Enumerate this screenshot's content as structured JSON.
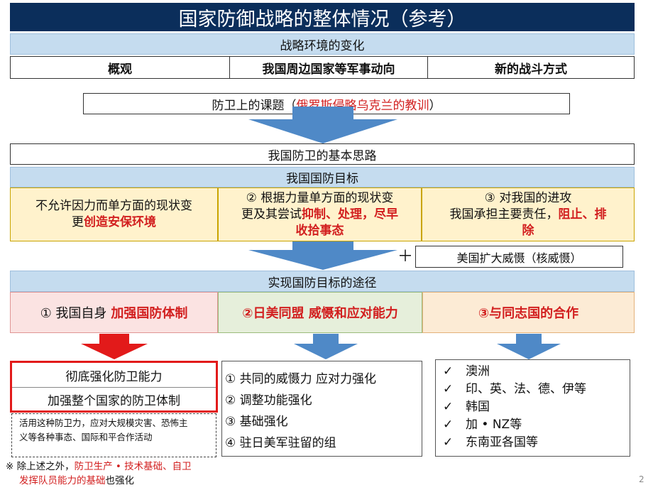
{
  "title": "国家防御战略的整体情况（参考）",
  "env_change": "战略环境的变化",
  "env_columns": [
    "概观",
    "我国周边国家等军事动向",
    "新的战斗方式"
  ],
  "issues": {
    "prefix": "防卫上的课题（",
    "highlight": "俄罗斯侵略乌克兰的教训",
    "suffix": "）"
  },
  "basic_thinking": "我国防卫的基本思路",
  "defense_goals_header": "我国国防目标",
  "goals": {
    "g1": {
      "line1": "不允许因力而单方面的现状变",
      "line2_plain": "更",
      "line2_red": "创造安保环境"
    },
    "g2": {
      "line1": "② 根据力量单方面的现状变",
      "line2_plain": "更及其尝试",
      "line2_red": "抑制、处理，尽早",
      "line3_red": "收拾事态"
    },
    "g3": {
      "line1": "③ 对我国的进攻",
      "line2_plain": "我国承担主要责任，",
      "line2_red": "阻止、排",
      "line3_red": "除"
    }
  },
  "plus": "＋",
  "us_deterrence": "美国扩大威慑（核威慑）",
  "means_header": "实现国防目标的途径",
  "means": {
    "m1_plain": "① 我国自身 ",
    "m1_red": "加强国防体制",
    "m2": "②日美同盟 威慑和应对能力",
    "m3": "③与同志国的合作"
  },
  "own_defense": [
    "彻底强化防卫能力",
    "加强整个国家的防卫体制"
  ],
  "note_box": [
    "活用这种防卫力，应对大规模灾害、恐怖主",
    "义等各种事态、国际和平合作活动"
  ],
  "alliance_items": [
    "① 共同的威慑力 应对力强化",
    "② 调整功能强化",
    "③ 基础强化",
    "④ 驻日美军驻留的组"
  ],
  "partners": [
    "澳洲",
    "印、英、法、德、伊等",
    "韩国",
    "加 • NZ等",
    "东南亚各国等"
  ],
  "check_mark": "✓",
  "footnote": {
    "line1_plain": "※ 除上述之外，",
    "line1_red": "防卫生产 • 技术基础、自卫",
    "line2_red": "发挥队员能力的基础",
    "line2_plain": "也强化"
  },
  "page_number": "2",
  "colors": {
    "title_bg": "#0b2e5b",
    "section_bg": "#c5dcef",
    "goal_bg": "#fff2cc",
    "means1_bg": "#fbe3e2",
    "means2_bg": "#e6efdb",
    "means3_bg": "#fcebd5",
    "arrow_blue": "#4f89c7",
    "arrow_red": "#e21a1a",
    "accent_red": "#d21f1f"
  }
}
